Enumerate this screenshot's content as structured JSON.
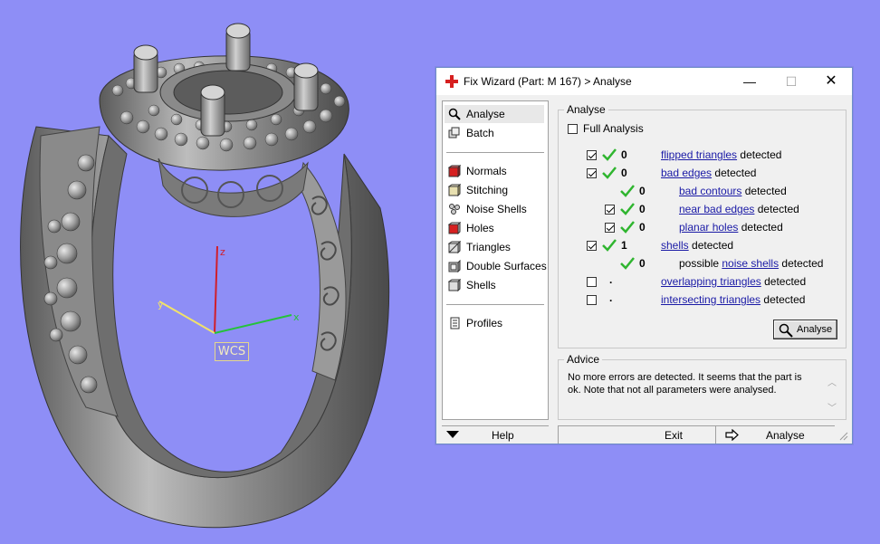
{
  "viewport": {
    "wcs_label": "WCS",
    "axis_z": "z",
    "axis_y": "y",
    "axis_x": "x",
    "background_color": "#8e8ef6"
  },
  "dialog": {
    "title": "Fix Wizard (Part: M 167) > Analyse",
    "window_buttons": {
      "minimize": "—",
      "maximize": "☐",
      "close": "✕"
    }
  },
  "nav": {
    "items": [
      {
        "label": "Analyse",
        "icon": "magnifier-icon",
        "selected": true
      },
      {
        "label": "Batch",
        "icon": "batch-icon"
      },
      {
        "label": "Normals",
        "icon": "normals-cube-icon"
      },
      {
        "label": "Stitching",
        "icon": "stitching-cube-icon"
      },
      {
        "label": "Noise Shells",
        "icon": "noise-shells-icon"
      },
      {
        "label": "Holes",
        "icon": "holes-cube-icon"
      },
      {
        "label": "Triangles",
        "icon": "triangles-cube-icon"
      },
      {
        "label": "Double Surfaces",
        "icon": "double-surfaces-icon"
      },
      {
        "label": "Shells",
        "icon": "shells-cube-icon"
      },
      {
        "label": "Profiles",
        "icon": "profiles-icon"
      }
    ]
  },
  "analyse": {
    "group_title": "Analyse",
    "full_analysis_label": "Full Analysis",
    "detected_word": "detected",
    "possible_word": "possible",
    "rows": {
      "flipped": {
        "count": "0",
        "link": "flipped triangles"
      },
      "bad_edges": {
        "count": "0",
        "link": "bad edges"
      },
      "bad_contours": {
        "count": "0",
        "link": "bad contours"
      },
      "near_bad_edges": {
        "count": "0",
        "link": "near bad edges"
      },
      "planar_holes": {
        "count": "0",
        "link": "planar holes"
      },
      "shells": {
        "count": "1",
        "link": "shells"
      },
      "noise_shells": {
        "count": "0",
        "link": "noise shells"
      },
      "overlapping": {
        "count": ".",
        "link": "overlapping triangles"
      },
      "intersecting": {
        "count": ".",
        "link": "intersecting triangles"
      }
    },
    "analyse_button": "Analyse"
  },
  "advice": {
    "group_title": "Advice",
    "text": "No more errors are detected. It seems that the part is ok. Note that not all parameters were analysed."
  },
  "bottom": {
    "help_label": "Help",
    "exit_label": "Exit",
    "analyse_label": "Analyse"
  },
  "colors": {
    "link": "#1a1aa6",
    "check_green": "#2fb52f",
    "icon_red": "#d62020"
  }
}
